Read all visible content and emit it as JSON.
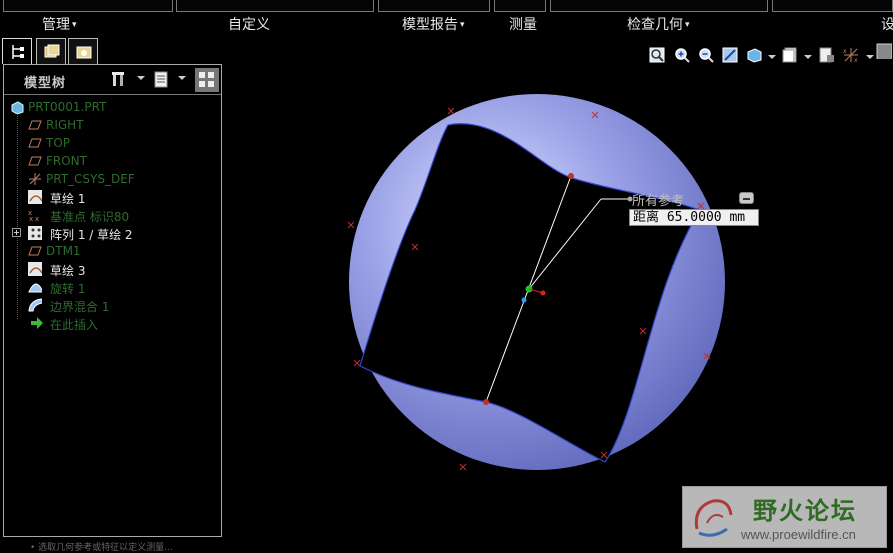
{
  "ribbon": {
    "groups": [
      {
        "label": "管理",
        "caret": "▾"
      },
      {
        "label": "自定义",
        "caret": ""
      },
      {
        "label": "模型报告",
        "caret": "▾"
      },
      {
        "label": "测量",
        "caret": ""
      },
      {
        "label": "检查几何",
        "caret": "▾"
      },
      {
        "label": "设",
        "caret": ""
      }
    ]
  },
  "left_tabs": [
    {
      "icon": "model-tree-icon"
    },
    {
      "icon": "folder-browser-icon"
    },
    {
      "icon": "favorites-icon"
    }
  ],
  "model_tree": {
    "title": "模型树",
    "items": [
      {
        "label": "PRT0001.PRT",
        "icon": "part-icon"
      },
      {
        "label": "RIGHT",
        "icon": "datum-plane-icon"
      },
      {
        "label": "TOP",
        "icon": "datum-plane-icon"
      },
      {
        "label": "FRONT",
        "icon": "datum-plane-icon"
      },
      {
        "label": "PRT_CSYS_DEF",
        "icon": "csys-icon"
      },
      {
        "label": "草绘 1",
        "icon": "sketch-icon"
      },
      {
        "label": "基准点 标识80",
        "icon": "datum-point-icon"
      },
      {
        "label": "阵列 1 / 草绘 2",
        "icon": "pattern-icon"
      },
      {
        "label": "DTM1",
        "icon": "datum-plane-icon"
      },
      {
        "label": "草绘 3",
        "icon": "sketch-icon"
      },
      {
        "label": "旋转 1",
        "icon": "revolve-icon"
      },
      {
        "label": "边界混合 1",
        "icon": "boundary-blend-icon"
      },
      {
        "label": "在此插入",
        "icon": "insert-here-icon"
      }
    ]
  },
  "measure_popup": {
    "title": "所有参考",
    "value_text": "距离 65.0000 mm"
  },
  "watermark": {
    "title": "野火论坛",
    "url": "www.proewildfire.cn"
  },
  "statusbar": {
    "text": "• 选取几何参考或特征以定义测量..."
  },
  "colors": {
    "sphere": "#8c93dc",
    "green_dim": "#2e6b2e",
    "datum_icon": "#c08060"
  }
}
